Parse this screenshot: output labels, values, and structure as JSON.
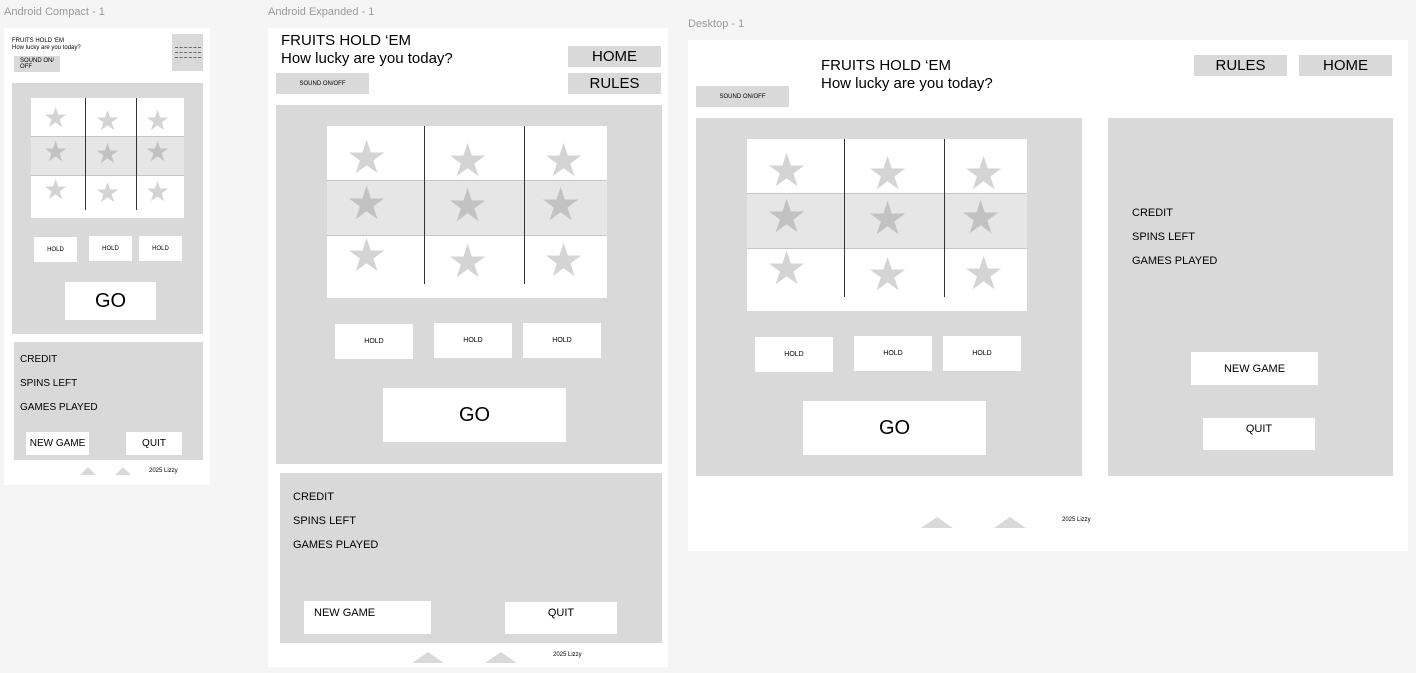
{
  "colors": {
    "canvas": "#f5f5f5",
    "frame": "#ffffff",
    "panel": "#d9d9d9",
    "star_light": "#d4d4d4",
    "star_dark": "#c2c2c2"
  },
  "compact": {
    "frame_label": "Android Compact - 1",
    "title": "FRUITS HOLD ‘EM",
    "subtitle": "How lucky are you today?",
    "sound_toggle": "SOUND ON/\nOFF",
    "menu_icon": "menu-lines-icon",
    "reel_symbol": "★",
    "hold_buttons": [
      "HOLD",
      "HOLD",
      "HOLD"
    ],
    "go": "GO",
    "stats": [
      "CREDIT",
      "SPINS LEFT",
      "GAMES PLAYED"
    ],
    "new_game": "NEW GAME",
    "quit": "QUIT",
    "footer": "2025 Lizzy"
  },
  "expanded": {
    "frame_label": "Android Expanded - 1",
    "title": "FRUITS HOLD ‘EM",
    "subtitle": "How lucky are you today?",
    "sound_toggle": "SOUND ON/OFF",
    "home": "HOME",
    "rules": "RULES",
    "reel_symbol": "★",
    "hold_buttons": [
      "HOLD",
      "HOLD",
      "HOLD"
    ],
    "go": "GO",
    "stats": [
      "CREDIT",
      "SPINS LEFT",
      "GAMES PLAYED"
    ],
    "new_game": "NEW GAME",
    "quit": "QUIT",
    "footer": "2025 Lizzy"
  },
  "desktop": {
    "frame_label": "Desktop - 1",
    "title": "FRUITS HOLD ‘EM",
    "subtitle": "How lucky are you today?",
    "sound_toggle": "SOUND ON/OFF",
    "rules": "RULES",
    "home": "HOME",
    "reel_symbol": "★",
    "hold_buttons": [
      "HOLD",
      "HOLD",
      "HOLD"
    ],
    "go": "GO",
    "stats": [
      "CREDIT",
      "SPINS LEFT",
      "GAMES PLAYED"
    ],
    "new_game": "NEW GAME",
    "quit": "QUIT",
    "footer": "2025 Lizzy"
  }
}
